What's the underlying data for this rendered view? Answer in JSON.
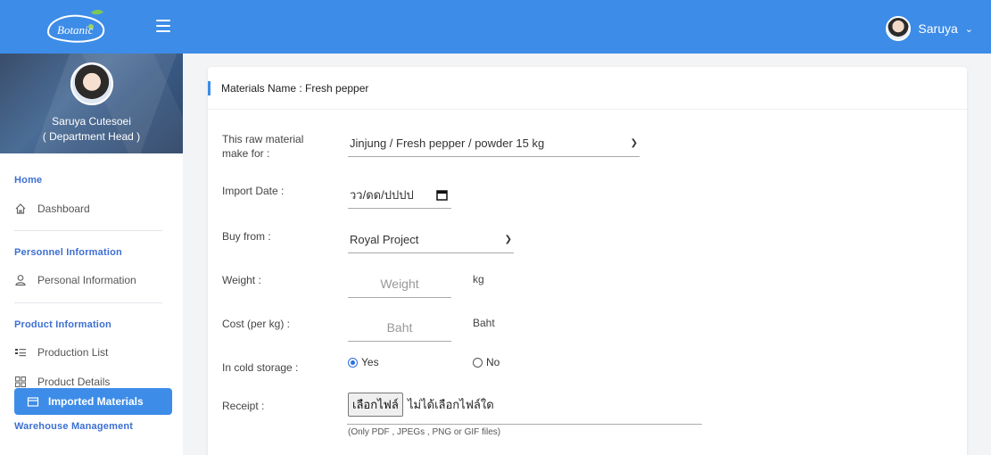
{
  "header": {
    "logo_text": "Botanic",
    "user_name": "Saruya"
  },
  "sidebar": {
    "profile_name": "Saruya Cutesoei",
    "profile_role": "( Department Head )",
    "sections": {
      "home": "Home",
      "personnel": "Personnel Information",
      "product": "Product Information",
      "warehouse": "Warehouse Management"
    },
    "items": {
      "dashboard": "Dashboard",
      "personal_info": "Personal Information",
      "production_list": "Production List",
      "product_details": "Product Details",
      "imported_materials": "Imported Materials"
    },
    "icons": {
      "dashboard": "home-icon",
      "personal_info": "user-icon",
      "production_list": "list-icon",
      "product_details": "grid-icon",
      "imported_materials": "box-icon"
    }
  },
  "form": {
    "card_title": "Materials Name : Fresh pepper",
    "raw_material_label_1": "This raw material",
    "raw_material_label_2": "make for :",
    "raw_material_value": "Jinjung / Fresh pepper / powder 15 kg",
    "import_date_label": "Import Date :",
    "import_date_value": "วว/ดด/ปปปป",
    "buy_from_label": "Buy from :",
    "buy_from_value": "Royal Project",
    "weight_label": "Weight :",
    "weight_placeholder": "Weight",
    "weight_unit": "kg",
    "cost_label": "Cost (per kg) :",
    "cost_placeholder": "Baht",
    "cost_unit": "Baht",
    "cold_storage_label": "In cold storage :",
    "yes_label": "Yes",
    "no_label": "No",
    "cold_storage_selected": "Yes",
    "receipt_label": "Receipt :",
    "file_button": "เลือกไฟล์",
    "file_status": "ไม่ได้เลือกไฟล์ใด",
    "file_hint": "(Only PDF , JPEGs , PNG or GIF files)"
  },
  "colors": {
    "primary": "#3d8ce8",
    "section_title": "#3d6fd1"
  }
}
